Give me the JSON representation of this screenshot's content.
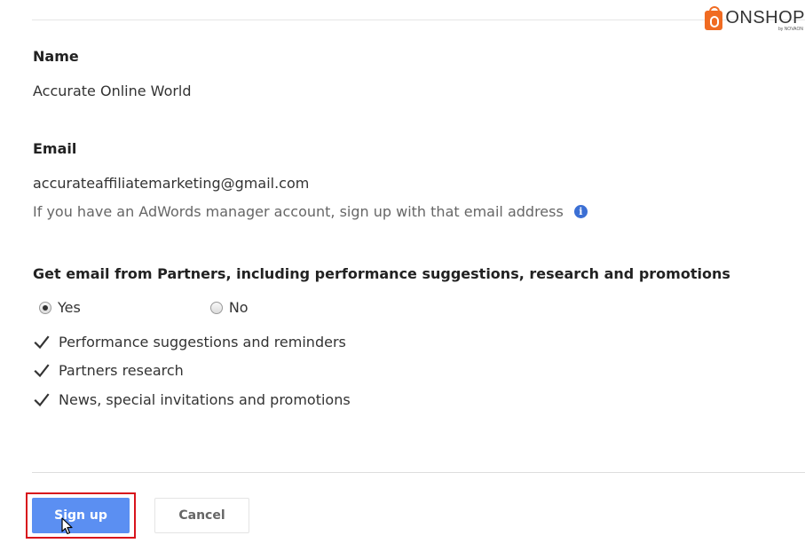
{
  "watermark": {
    "title": "ONSHOP",
    "subtitle": "by NOVAON"
  },
  "form": {
    "name_label": "Name",
    "name_value": "Accurate Online World",
    "email_label": "Email",
    "email_value": "accurateaffiliatemarketing@gmail.com",
    "email_hint": "If you have an AdWords manager account, sign up with that email address",
    "info_icon_glyph": "i",
    "partners_email_label": "Get email from Partners, including performance suggestions, research and promotions",
    "radio_options": [
      {
        "label": "Yes",
        "selected": true
      },
      {
        "label": "No",
        "selected": false
      }
    ],
    "checkboxes": [
      {
        "label": "Performance suggestions and reminders",
        "checked": true
      },
      {
        "label": "Partners research",
        "checked": true
      },
      {
        "label": "News, special invitations and promotions",
        "checked": true
      }
    ]
  },
  "actions": {
    "signup_label": "Sign up",
    "cancel_label": "Cancel"
  },
  "colors": {
    "primary_button": "#5b8ff2",
    "highlight_border": "#d8141c",
    "info_icon": "#3b6fd4",
    "brand_orange": "#f06b22"
  }
}
